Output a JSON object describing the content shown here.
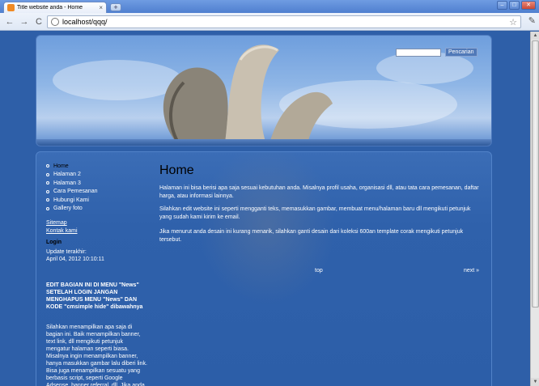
{
  "browser": {
    "tab_title": "Title website anda - Home",
    "tab_close": "×",
    "newtab": "+",
    "url_host": "localhost/qqq/",
    "back": "←",
    "forward": "→",
    "reload": "C",
    "star": "☆",
    "wrench": "✎",
    "minimize": "–",
    "maximize": "□",
    "close": "✕"
  },
  "header": {
    "search_button": "Pencarian",
    "search_value": ""
  },
  "sidebar": {
    "menu": [
      {
        "label": "Home",
        "active": true
      },
      {
        "label": "Halaman 2"
      },
      {
        "label": "Halaman 3"
      },
      {
        "label": "Cara Pemesanan"
      },
      {
        "label": "Hubungi Kami"
      },
      {
        "label": "Gallery foto"
      }
    ],
    "links": [
      "Sitemap",
      "Kontak kami"
    ],
    "login_heading": "Login",
    "update_label": "Update terakhir:",
    "update_time": "April 04, 2012 10:10:11",
    "edit_note": "EDIT BAGIAN INI DI MENU \"News\" SETELAH LOGIN JANGAN MENGHAPUS MENU \"News\" DAN KODE \"cmsimple hide\" dibawahnya",
    "side_text": "Silahkan menampilkan apa saja di bagian ini. Baik menampilkan banner, text link, dll mengikuti petunjuk mengatur halaman seperti biasa. Misalnya ingin menampilkan banner, hanya masukkan gambar lalu diberi link. Bisa juga menampilkan sesuatu yang berbasis script, seperti Google Adsense, banner referral, dll. Jika anda"
  },
  "main": {
    "title": "Home",
    "p1": "Halaman ini bisa berisi apa saja sesuai kebutuhan anda. Misalnya profil usaha, organisasi dll, atau tata cara pemesanan, daftar harga, atau informasi lainnya.",
    "p2": "Silahkan edit website ini seperti mengganti teks, memasukkan gambar, membuat menu/halaman baru dll mengikuti petunjuk yang sudah kami kirim ke email.",
    "p3": "Jika menurut anda desain ini kurang menarik, silahkan ganti desain dari koleksi 600an template corak mengikuti petunjuk tersebut.",
    "top_link": "top",
    "next_link": "next »"
  }
}
